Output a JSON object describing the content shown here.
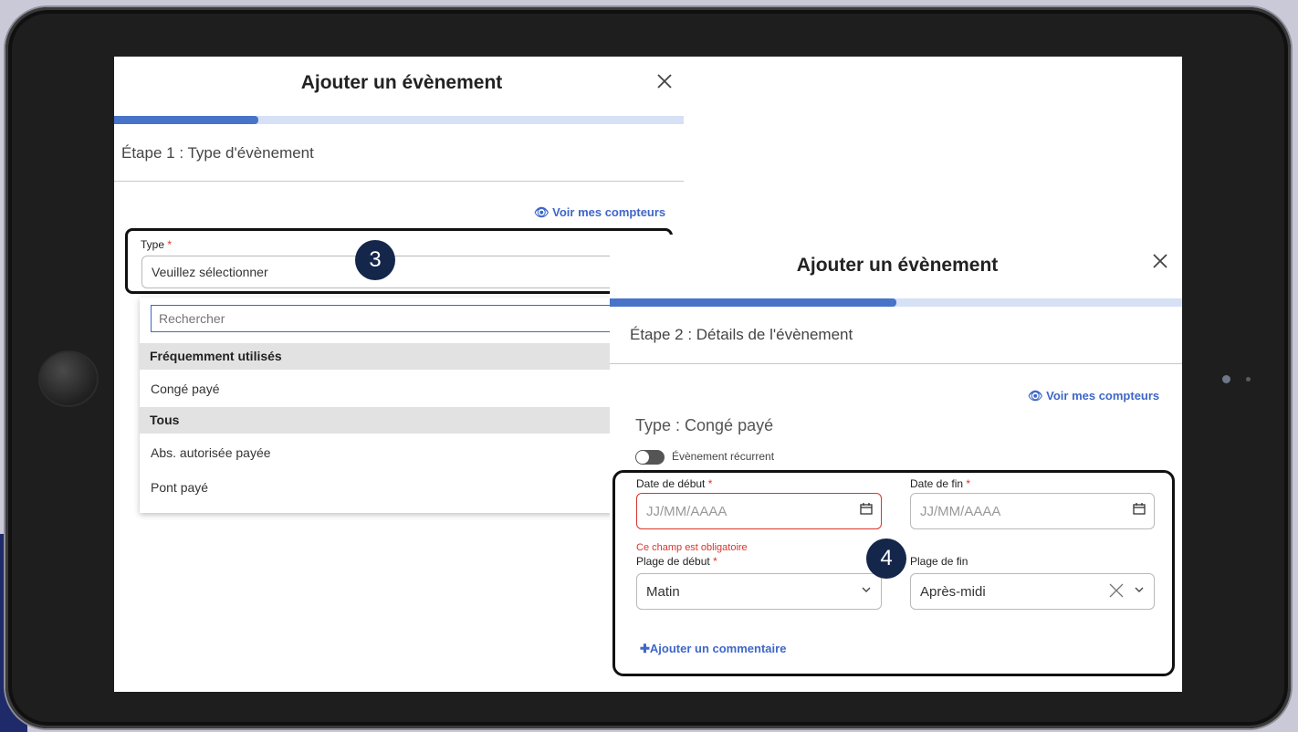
{
  "panel1": {
    "title": "Ajouter un évènement",
    "step": "Étape 1 : Type d'évènement",
    "counters_link": "Voir mes compteurs",
    "type_label": "Type",
    "required_marker": "*",
    "type_placeholder": "Veuillez sélectionner",
    "search_placeholder": "Rechercher",
    "group_frequent": "Fréquemment utilisés",
    "frequent_options": [
      "Congé payé"
    ],
    "group_all": "Tous",
    "all_options": [
      "Abs. autorisée payée",
      "Pont payé"
    ],
    "progress_fraction": 0.25
  },
  "badges": [
    "3",
    "4"
  ],
  "panel2": {
    "title": "Ajouter un évènement",
    "step": "Étape 2 : Détails de l'évènement",
    "counters_link": "Voir mes compteurs",
    "type_line": "Type : Congé payé",
    "recurring_label": "Évènement récurrent",
    "recurring_on": false,
    "start_date_label": "Date de début",
    "end_date_label": "Date de fin",
    "required_marker": "*",
    "date_placeholder": "JJ/MM/AAAA",
    "error_text": "Ce champ est obligatoire",
    "start_range_label": "Plage de début",
    "end_range_label": "Plage de fin",
    "start_range_value": "Matin",
    "end_range_value": "Après-midi",
    "add_comment": "Ajouter un commentaire",
    "progress_fraction": 0.5
  },
  "colors": {
    "accent": "#3f67c8",
    "progress": "#4773c9",
    "progress_track": "#d6e1f5",
    "error": "#d9342b",
    "badge": "#14264a",
    "tablet_body": "#1e1e1e"
  },
  "icons": [
    "close-icon",
    "eye-icon",
    "calendar-icon",
    "chevron-down-icon",
    "clear-icon",
    "plus-icon",
    "toggle-switch"
  ]
}
